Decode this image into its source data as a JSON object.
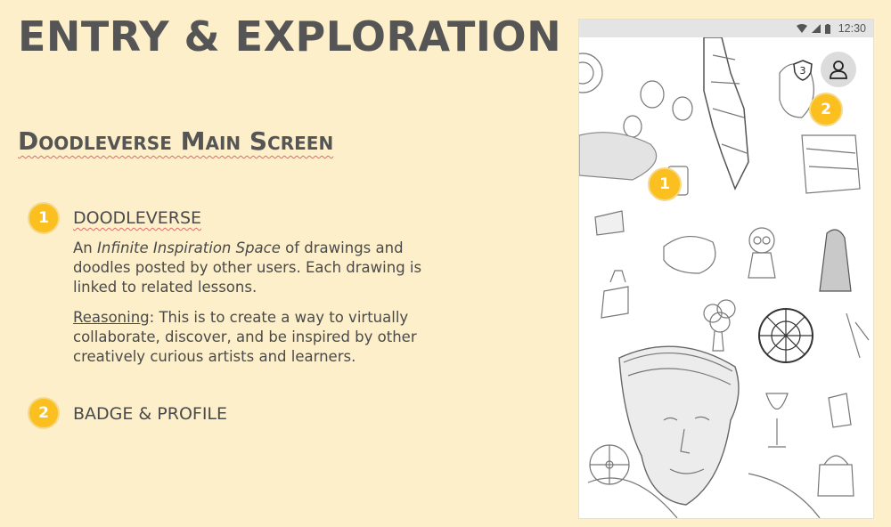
{
  "page": {
    "title": "ENTRY & EXPLORATION",
    "subtitle": "Doodleverse Main Screen"
  },
  "sections": [
    {
      "number": "1",
      "heading": "DOODLEVERSE",
      "desc_intro": "An ",
      "desc_emphasis": "Infinite Inspiration Space",
      "desc_rest": " of drawings and doodles posted by other users. Each drawing is linked to related lessons.",
      "reasoning_label": "Reasoning",
      "reasoning_text": ": This is to create a way to virtually collaborate, discover, and be inspired by other creatively curious artists and learners."
    },
    {
      "number": "2",
      "heading": "BADGE & PROFILE"
    }
  ],
  "phone": {
    "status_time": "12:30",
    "badge_count": "3",
    "marker_1": "1",
    "marker_2": "2",
    "icons": [
      "wifi-icon",
      "signal-icon",
      "battery-icon",
      "shield-badge-icon",
      "user-profile-icon"
    ]
  },
  "colors": {
    "background": "#fdefca",
    "marker": "#fbbf1f",
    "text": "#4a4a4a"
  }
}
